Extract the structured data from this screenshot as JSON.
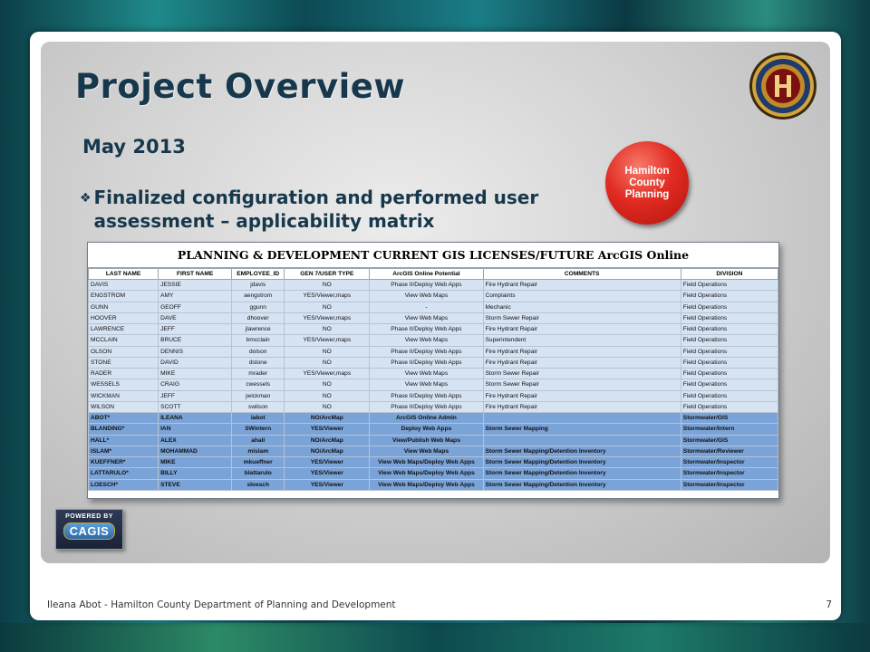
{
  "slide": {
    "title": "Project Overview",
    "subtitle": "May 2013",
    "bullet": "Finalized configuration and performed user assessment – applicability matrix",
    "badge": "Hamilton County Planning",
    "footer": "Ileana Abot - Hamilton County Department of Planning and Development",
    "page_number": "7",
    "logo": {
      "powered_by": "POWERED BY",
      "name": "CAGIS"
    }
  },
  "matrix": {
    "title": "PLANNING & DEVELOPMENT CURRENT GIS LICENSES/FUTURE ArcGIS Online",
    "columns": [
      "LAST NAME",
      "FIRST NAME",
      "EMPLOYEE_ID",
      "GEN 7/USER TYPE",
      "ArcGIS Online Potential",
      "COMMENTS",
      "DIVISION"
    ],
    "rows": [
      {
        "style": "lic",
        "cells": [
          "DAVIS",
          "JESSIE",
          "jdavis",
          "NO",
          "Phase II/Deploy Web Apps",
          "Fire Hydrant Repair",
          "Field Operations"
        ]
      },
      {
        "style": "lic",
        "cells": [
          "ENGSTROM",
          "AMY",
          "aengstrom",
          "YES/Viewer,maps",
          "View Web Maps",
          "Complaints",
          "Field Operations"
        ]
      },
      {
        "style": "lic",
        "cells": [
          "GUNN",
          "GEOFF",
          "ggunn",
          "NO",
          "-",
          "Mechanic",
          "Field Operations"
        ]
      },
      {
        "style": "lic",
        "cells": [
          "HOOVER",
          "DAVE",
          "dhoover",
          "YES/Viewer,maps",
          "View Web Maps",
          "Storm Sewer Repair",
          "Field Operations"
        ]
      },
      {
        "style": "lic",
        "cells": [
          "LAWRENCE",
          "JEFF",
          "jlawrence",
          "NO",
          "Phase II/Deploy Web Apps",
          "Fire Hydrant Repair",
          "Field Operations"
        ]
      },
      {
        "style": "lic",
        "cells": [
          "MCCLAIN",
          "BRUCE",
          "bmcclain",
          "YES/Viewer,maps",
          "View Web Maps",
          "Superintendent",
          "Field Operations"
        ]
      },
      {
        "style": "lic",
        "cells": [
          "OLSON",
          "DENNIS",
          "dolson",
          "NO",
          "Phase II/Deploy Web Apps",
          "Fire Hydrant Repair",
          "Field Operations"
        ]
      },
      {
        "style": "lic",
        "cells": [
          "STONE",
          "DAVID",
          "dstone",
          "NO",
          "Phase II/Deploy Web Apps",
          "Fire Hydrant Repair",
          "Field Operations"
        ]
      },
      {
        "style": "lic",
        "cells": [
          "RADER",
          "MIKE",
          "mrader",
          "YES/Viewer,maps",
          "View Web Maps",
          "Storm Sewer Repair",
          "Field Operations"
        ]
      },
      {
        "style": "lic",
        "cells": [
          "WESSELS",
          "CRAIG",
          "cwessels",
          "NO",
          "View Web Maps",
          "Storm Sewer Repair",
          "Field Operations"
        ]
      },
      {
        "style": "lic",
        "cells": [
          "WICKMAN",
          "JEFF",
          "jwickman",
          "NO",
          "Phase II/Deploy Web Apps",
          "Fire Hydrant Repair",
          "Field Operations"
        ]
      },
      {
        "style": "lic",
        "cells": [
          "WILSON",
          "SCOTT",
          "swilson",
          "NO",
          "Phase II/Deploy Web Apps",
          "Fire Hydrant Repair",
          "Field Operations"
        ]
      },
      {
        "style": "sw",
        "cells": [
          "ABOT*",
          "ILEANA",
          "iabot",
          "NO/ArcMap",
          "ArcGIS Online Admin",
          "",
          "Stormwater/GIS"
        ]
      },
      {
        "style": "sw",
        "cells": [
          "BLANDING*",
          "IAN",
          "SWintern",
          "YES/Viewer",
          "Deploy Web Apps",
          "Storm Sewer Mapping",
          "Stormwater/Intern"
        ]
      },
      {
        "style": "sw",
        "cells": [
          "HALL*",
          "ALEX",
          "ahall",
          "NO/ArcMap",
          "View/Publish Web Maps",
          "",
          "Stormwater/GIS"
        ]
      },
      {
        "style": "sw",
        "cells": [
          "ISLAM*",
          "MOHAMMAD",
          "mislam",
          "NO/ArcMap",
          "View Web Maps",
          "Storm Sewer Mapping/Detention Inventory",
          "Stormwater/Reviewer"
        ]
      },
      {
        "style": "sw",
        "cells": [
          "KUEFFNER*",
          "MIKE",
          "mkueffner",
          "YES/Viewer",
          "View Web Maps/Deploy Web Apps",
          "Storm Sewer Mapping/Detention Inventory",
          "Stormwater/Inspector"
        ]
      },
      {
        "style": "sw",
        "cells": [
          "LATTARULO*",
          "BILLY",
          "blattarulo",
          "YES/Viewer",
          "View Web Maps/Deploy Web Apps",
          "Storm Sewer Mapping/Detention Inventory",
          "Stormwater/Inspector"
        ]
      },
      {
        "style": "sw",
        "cells": [
          "LOESCH*",
          "STEVE",
          "sloesch",
          "YES/Viewer",
          "View Web Maps/Deploy Web Apps",
          "Storm Sewer Mapping/Detention Inventory",
          "Stormwater/Inspector"
        ]
      }
    ]
  },
  "colors": {
    "title": "#17384c",
    "badge": "#e12c22",
    "license_row": "#d6e3f3",
    "stormwater_row": "#7aa3d8"
  },
  "icons": {
    "bullet": "diamond-bullet-icon",
    "seal": "county-seal-icon"
  }
}
